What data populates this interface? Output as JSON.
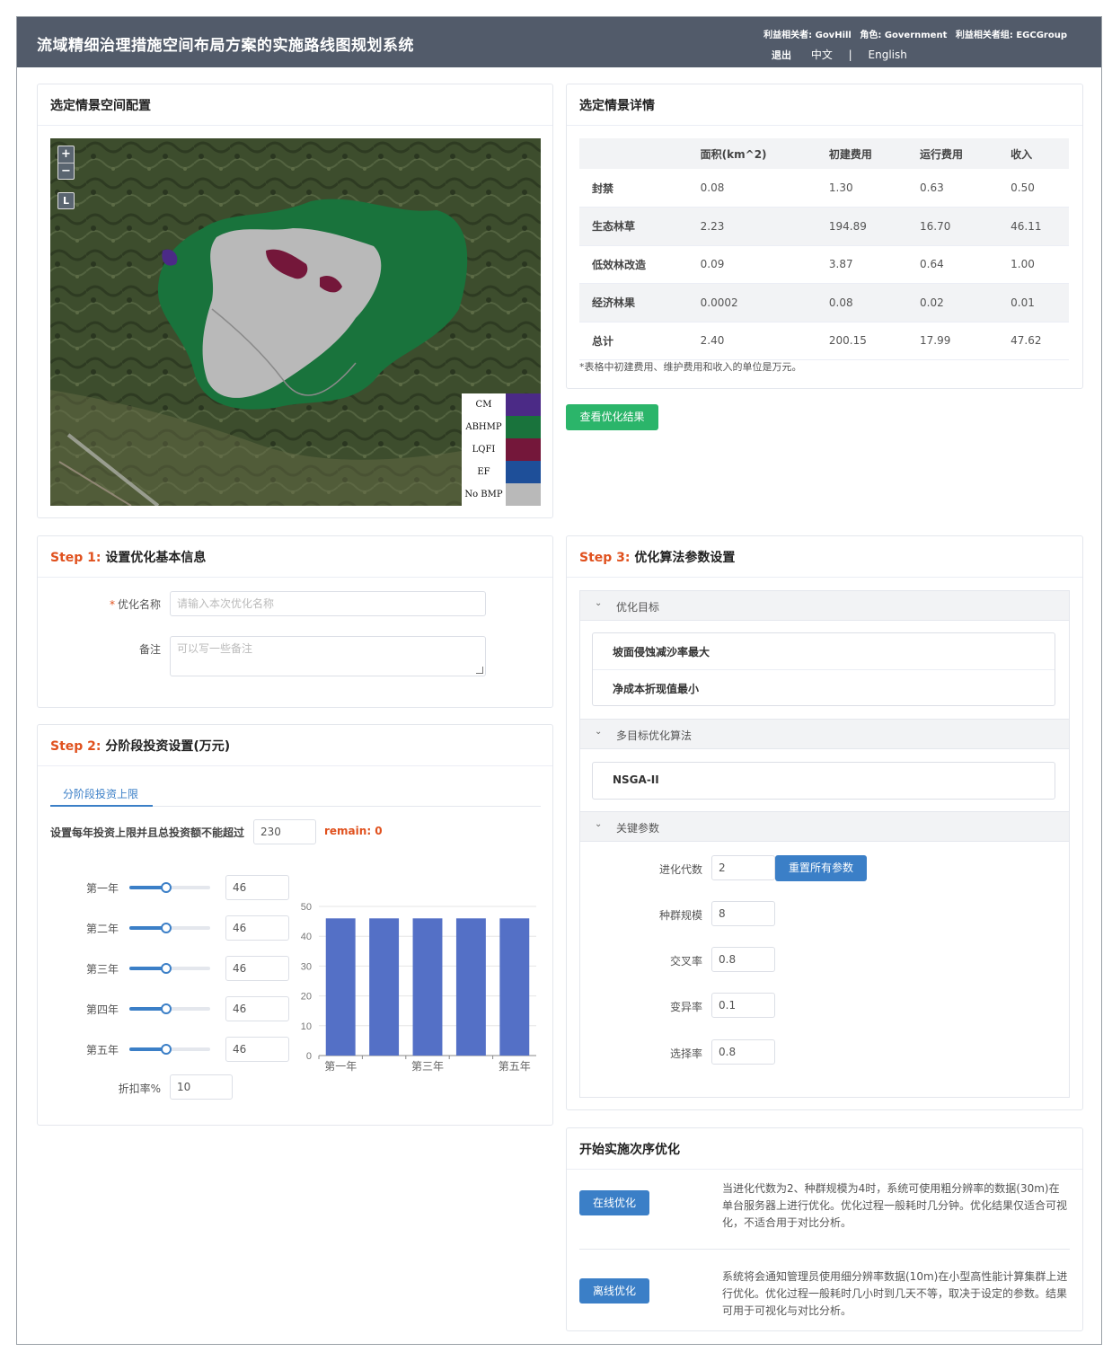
{
  "header": {
    "title": "流域精细治理措施空间布局方案的实施路线图规划系统",
    "stakeholder": "利益相关者: GovHill",
    "role": "角色: Government",
    "group": "利益相关者组: EGCGroup",
    "logout": "退出",
    "lang_zh": "中文",
    "lang_sep": "|",
    "lang_en": "English"
  },
  "map_card": {
    "title": "选定情景空间配置",
    "zoom_in": "+",
    "zoom_out": "−",
    "layer_btn": "L",
    "legend": [
      {
        "label": "CM",
        "color": "#4b2a86"
      },
      {
        "label": "ABHMP",
        "color": "#19733c"
      },
      {
        "label": "LQFI",
        "color": "#74173a"
      },
      {
        "label": "EF",
        "color": "#1e4f99"
      },
      {
        "label": "No BMP",
        "color": "#b9b9b9"
      }
    ]
  },
  "detail_card": {
    "title": "选定情景详情",
    "columns": [
      "",
      "面积(km^2)",
      "初建费用",
      "运行费用",
      "收入"
    ],
    "rows": [
      [
        "封禁",
        "0.08",
        "1.30",
        "0.63",
        "0.50"
      ],
      [
        "生态林草",
        "2.23",
        "194.89",
        "16.70",
        "46.11"
      ],
      [
        "低效林改造",
        "0.09",
        "3.87",
        "0.64",
        "1.00"
      ],
      [
        "经济林果",
        "0.0002",
        "0.08",
        "0.02",
        "0.01"
      ],
      [
        "总计",
        "2.40",
        "200.15",
        "17.99",
        "47.62"
      ]
    ],
    "note": "*表格中初建费用、维护费用和收入的单位是万元。",
    "view_button": "查看优化结果"
  },
  "step1": {
    "step": "Step 1:",
    "title": "设置优化基本信息",
    "name_label": "优化名称",
    "name_placeholder": "请输入本次优化名称",
    "remark_label": "备注",
    "remark_placeholder": "可以写一些备注"
  },
  "step2": {
    "step": "Step 2:",
    "title": "分阶段投资设置(万元)",
    "tab": "分阶段投资上限",
    "limit_label": "设置每年投资上限并且总投资额不能超过",
    "limit_value": "230",
    "remain": "remain: 0",
    "years": [
      {
        "label": "第一年",
        "value": "46",
        "slider": 0.46
      },
      {
        "label": "第二年",
        "value": "46",
        "slider": 0.46
      },
      {
        "label": "第三年",
        "value": "46",
        "slider": 0.46
      },
      {
        "label": "第四年",
        "value": "46",
        "slider": 0.46
      },
      {
        "label": "第五年",
        "value": "46",
        "slider": 0.46
      }
    ],
    "discount_label": "折扣率%",
    "discount_value": "10"
  },
  "chart_data": {
    "type": "bar",
    "categories": [
      "第一年",
      "第二年",
      "第三年",
      "第四年",
      "第五年"
    ],
    "tick_labels": [
      "第一年",
      "",
      "第三年",
      "",
      "第五年"
    ],
    "values": [
      46,
      46,
      46,
      46,
      46
    ],
    "ylim": [
      0,
      50
    ],
    "yticks": [
      0,
      10,
      20,
      30,
      40,
      50
    ],
    "color": "#5470c6"
  },
  "step3": {
    "step": "Step 3:",
    "title": "优化算法参数设置",
    "objective_head": "优化目标",
    "objectives": [
      "坡面侵蚀减沙率最大",
      "净成本折现值最小"
    ],
    "algo_head": "多目标优化算法",
    "algorithm": "NSGA-II",
    "params_head": "关键参数",
    "params": [
      {
        "label": "进化代数",
        "value": "2"
      },
      {
        "label": "种群规模",
        "value": "8"
      },
      {
        "label": "交叉率",
        "value": "0.8"
      },
      {
        "label": "变异率",
        "value": "0.1"
      },
      {
        "label": "选择率",
        "value": "0.8"
      }
    ],
    "reset_button": "重置所有参数",
    "chevron": "⌄"
  },
  "start": {
    "title": "开始实施次序优化",
    "online_button": "在线优化",
    "online_desc": "当进化代数为2、种群规模为4时，系统可使用粗分辨率的数据(30m)在单台服务器上进行优化。优化过程一般耗时几分钟。优化结果仅适合可视化，不适合用于对比分析。",
    "offline_button": "离线优化",
    "offline_desc": "系统将会通知管理员使用细分辨率数据(10m)在小型高性能计算集群上进行优化。优化过程一般耗时几小时到几天不等，取决于设定的参数。结果可用于可视化与对比分析。"
  }
}
